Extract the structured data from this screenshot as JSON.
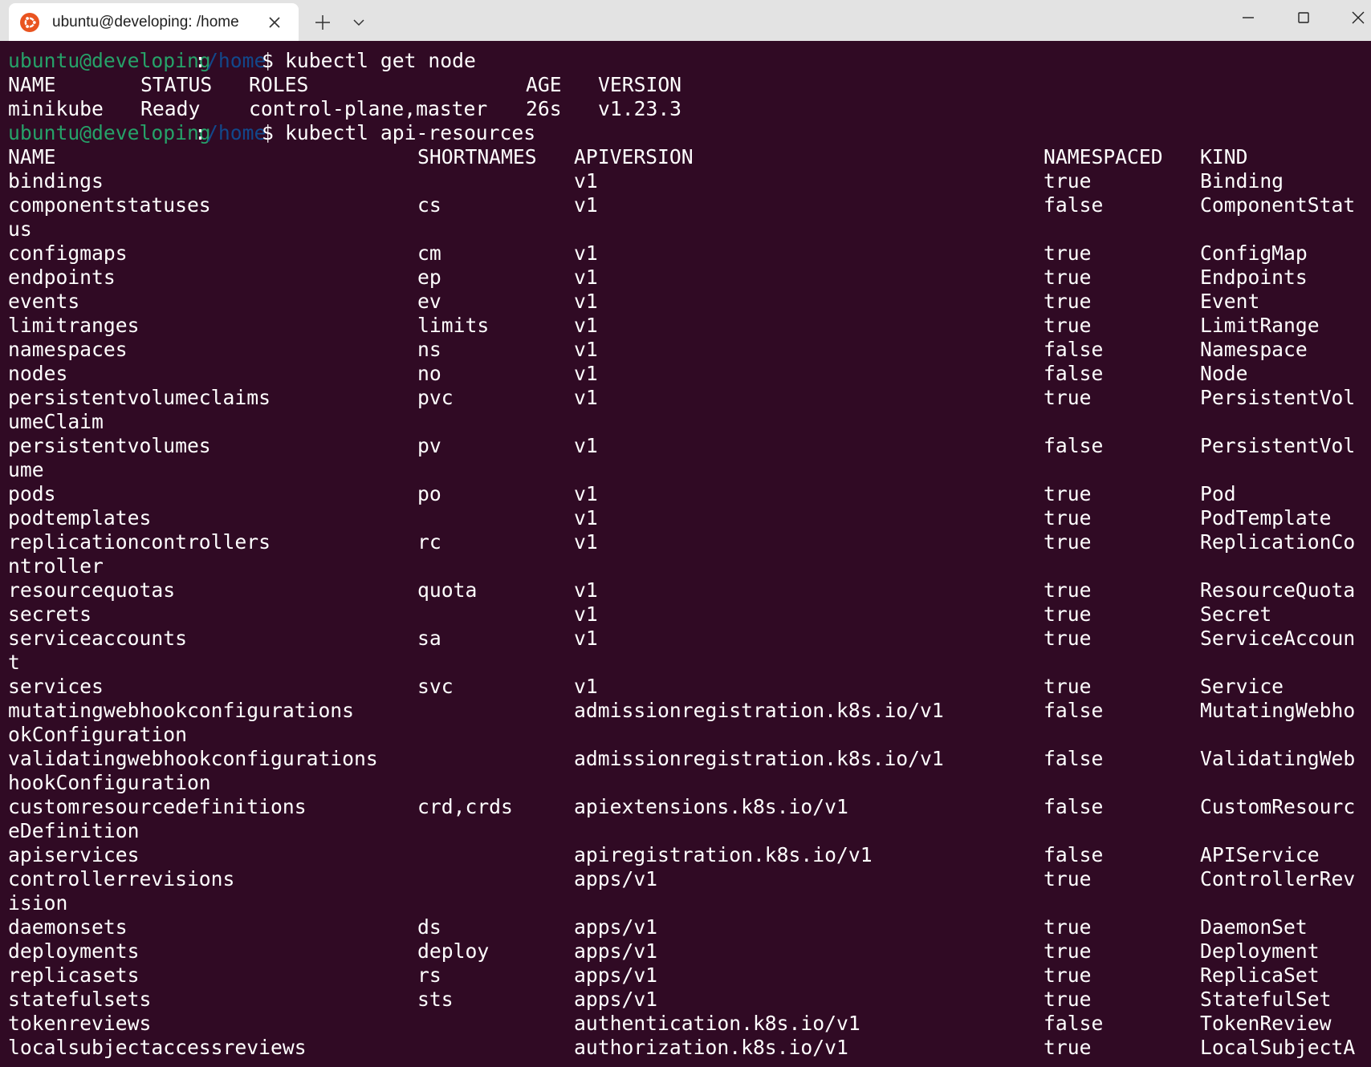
{
  "window": {
    "tab_title": "ubuntu@developing: /home",
    "tab_icon": "ubuntu-logo-icon",
    "accent": "#e95420"
  },
  "terminal": {
    "colors": {
      "background": "#300a24",
      "user": "#26a269",
      "path": "#12488b",
      "text": "#ffffff"
    },
    "prompt": {
      "user_host": "ubuntu@developing",
      "separator": ":",
      "path": "/home",
      "symbol": "$"
    },
    "commands": [
      "kubectl get node",
      "kubectl api-resources"
    ],
    "node_table": {
      "headers": [
        "NAME",
        "STATUS",
        "ROLES",
        "AGE",
        "VERSION"
      ],
      "rows": [
        [
          "minikube",
          "Ready",
          "control-plane,master",
          "26s",
          "v1.23.3"
        ]
      ]
    },
    "resources_table": {
      "headers": [
        "NAME",
        "SHORTNAMES",
        "APIVERSION",
        "NAMESPACED",
        "KIND"
      ],
      "rows": [
        [
          "bindings",
          "",
          "v1",
          "true",
          "Binding"
        ],
        [
          "componentstatuses",
          "cs",
          "v1",
          "false",
          "ComponentStat",
          "us"
        ],
        [
          "configmaps",
          "cm",
          "v1",
          "true",
          "ConfigMap"
        ],
        [
          "endpoints",
          "ep",
          "v1",
          "true",
          "Endpoints"
        ],
        [
          "events",
          "ev",
          "v1",
          "true",
          "Event"
        ],
        [
          "limitranges",
          "limits",
          "v1",
          "true",
          "LimitRange"
        ],
        [
          "namespaces",
          "ns",
          "v1",
          "false",
          "Namespace"
        ],
        [
          "nodes",
          "no",
          "v1",
          "false",
          "Node"
        ],
        [
          "persistentvolumeclaims",
          "pvc",
          "v1",
          "true",
          "PersistentVol",
          "umeClaim"
        ],
        [
          "persistentvolumes",
          "pv",
          "v1",
          "false",
          "PersistentVol",
          "ume"
        ],
        [
          "pods",
          "po",
          "v1",
          "true",
          "Pod"
        ],
        [
          "podtemplates",
          "",
          "v1",
          "true",
          "PodTemplate"
        ],
        [
          "replicationcontrollers",
          "rc",
          "v1",
          "true",
          "ReplicationCo",
          "ntroller"
        ],
        [
          "resourcequotas",
          "quota",
          "v1",
          "true",
          "ResourceQuota"
        ],
        [
          "secrets",
          "",
          "v1",
          "true",
          "Secret"
        ],
        [
          "serviceaccounts",
          "sa",
          "v1",
          "true",
          "ServiceAccoun",
          "t"
        ],
        [
          "services",
          "svc",
          "v1",
          "true",
          "Service"
        ],
        [
          "mutatingwebhookconfigurations",
          "",
          "admissionregistration.k8s.io/v1",
          "false",
          "MutatingWebho",
          "okConfiguration"
        ],
        [
          "validatingwebhookconfigurations",
          "",
          "admissionregistration.k8s.io/v1",
          "false",
          "ValidatingWeb",
          "hookConfiguration"
        ],
        [
          "customresourcedefinitions",
          "crd,crds",
          "apiextensions.k8s.io/v1",
          "false",
          "CustomResourc",
          "eDefinition"
        ],
        [
          "apiservices",
          "",
          "apiregistration.k8s.io/v1",
          "false",
          "APIService"
        ],
        [
          "controllerrevisions",
          "",
          "apps/v1",
          "true",
          "ControllerRev",
          "ision"
        ],
        [
          "daemonsets",
          "ds",
          "apps/v1",
          "true",
          "DaemonSet"
        ],
        [
          "deployments",
          "deploy",
          "apps/v1",
          "true",
          "Deployment"
        ],
        [
          "replicasets",
          "rs",
          "apps/v1",
          "true",
          "ReplicaSet"
        ],
        [
          "statefulsets",
          "sts",
          "apps/v1",
          "true",
          "StatefulSet"
        ],
        [
          "tokenreviews",
          "",
          "authentication.k8s.io/v1",
          "false",
          "TokenReview"
        ],
        [
          "localsubjectaccessreviews",
          "",
          "authorization.k8s.io/v1",
          "true",
          "LocalSubjectA"
        ]
      ]
    }
  }
}
